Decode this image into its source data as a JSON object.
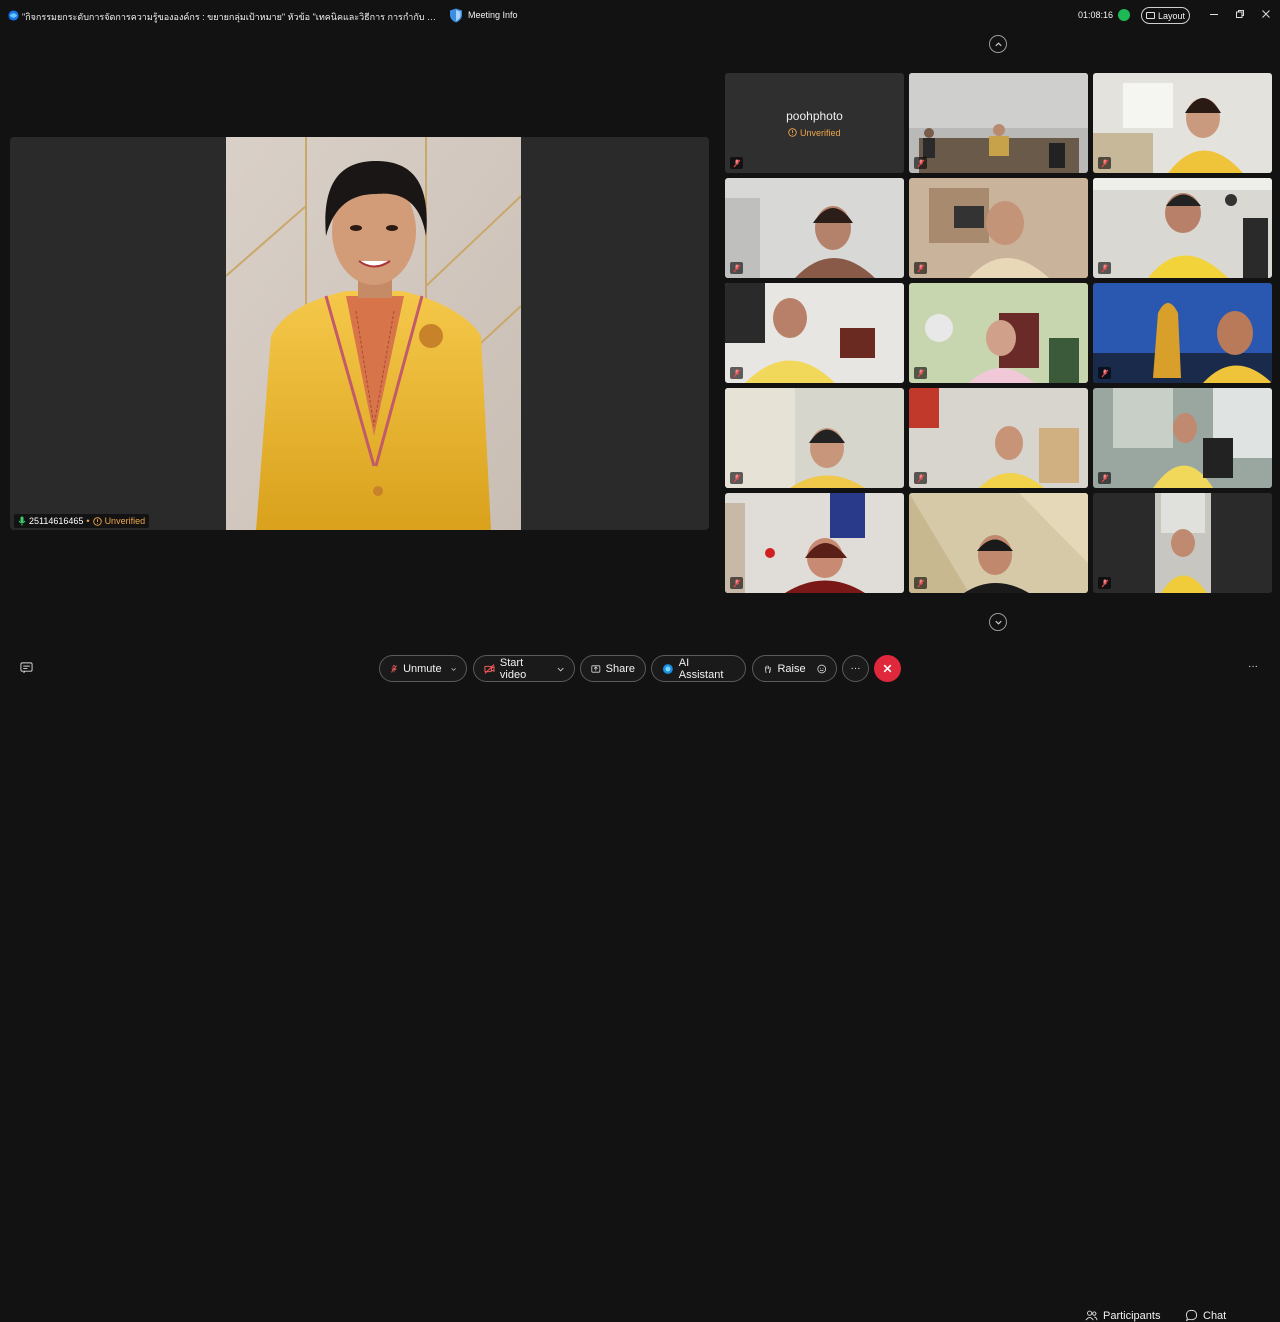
{
  "titlebar": {
    "title": "\"กิจกรรมยกระดับการจัดการความรู้ขององค์กร : ขยายกลุ่มเป้าหมาย\" หัวข้อ \"เทคนิคและวิธีการ การกำกับ ติดตาม การดำเนินงานต์...",
    "meeting_info": "Meeting Info",
    "timer": "01:08:16",
    "layout": "Layout"
  },
  "main_video": {
    "name": "25114616465",
    "separator": "•",
    "status": "Unverified"
  },
  "grid": {
    "tiles": [
      {
        "name": "poohphoto",
        "status": "Unverified",
        "muted": true
      },
      {
        "muted": true
      },
      {
        "muted": true
      },
      {
        "muted": true
      },
      {
        "muted": true
      },
      {
        "muted": true
      },
      {
        "muted": true
      },
      {
        "muted": true
      },
      {
        "muted": true
      },
      {
        "muted": true
      },
      {
        "muted": true
      },
      {
        "muted": true
      },
      {
        "muted": true
      },
      {
        "muted": true
      },
      {
        "muted": true
      }
    ]
  },
  "toolbar": {
    "unmute": "Unmute",
    "start_video": "Start video",
    "share": "Share",
    "ai_assistant": "AI Assistant",
    "raise": "Raise",
    "more": "···",
    "participants": "Participants",
    "chat": "Chat",
    "overflow": "···"
  },
  "colors": {
    "background": "#121212",
    "accent_unverified": "#f0a64b",
    "leave": "#e0283c",
    "secure_dot": "#1db954"
  }
}
